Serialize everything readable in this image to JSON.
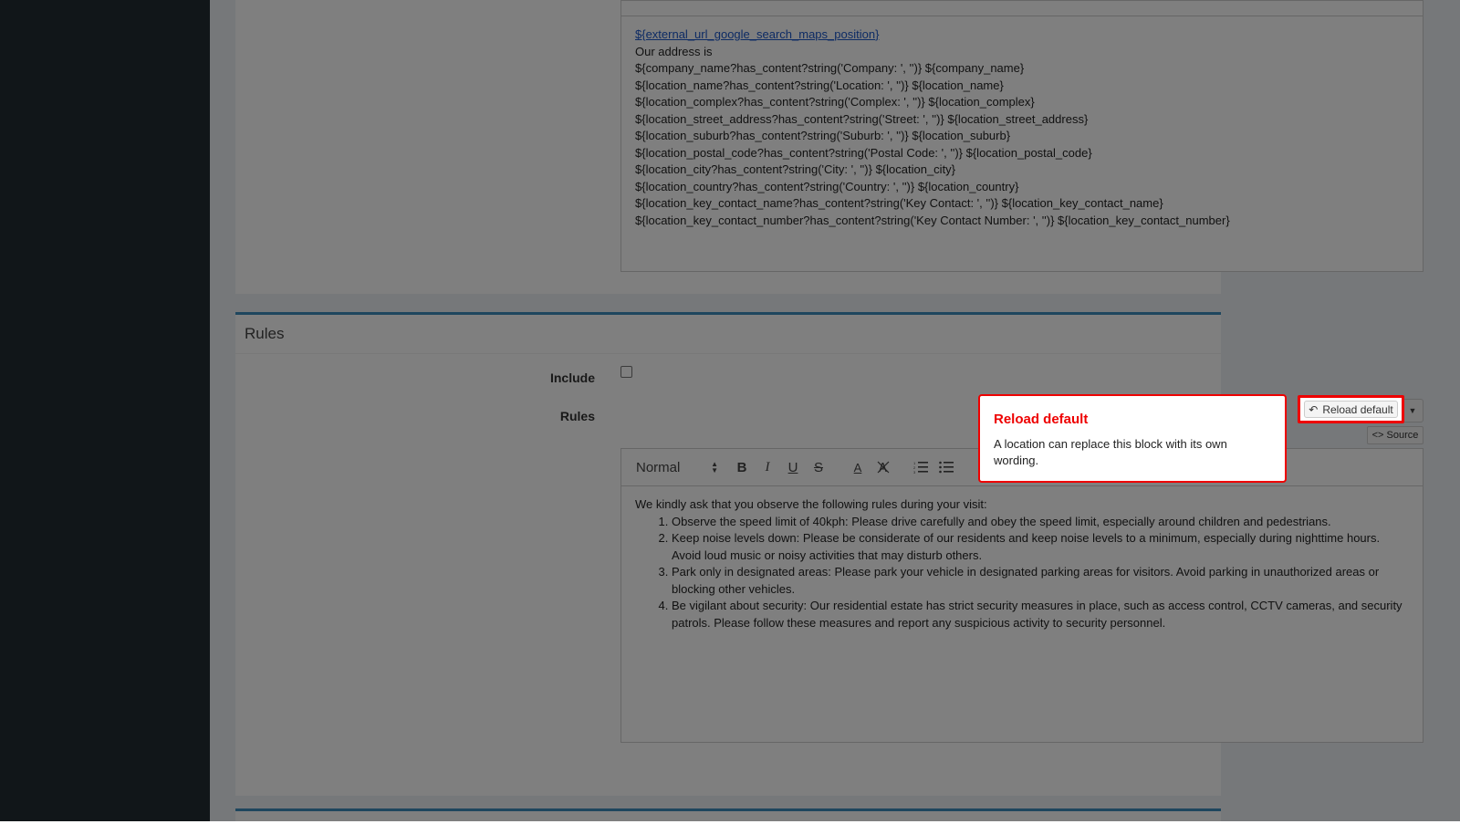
{
  "address_editor": {
    "link": "${external_url_google_search_maps_position}",
    "lines": [
      "Our address is",
      "${company_name?has_content?string('Company: ', '')} ${company_name}",
      "${location_name?has_content?string('Location: ', '')} ${location_name}",
      "${location_complex?has_content?string('Complex: ', '')} ${location_complex}",
      "${location_street_address?has_content?string('Street: ', '')} ${location_street_address}",
      "${location_suburb?has_content?string('Suburb: ', '')} ${location_suburb}",
      "${location_postal_code?has_content?string('Postal Code: ', '')} ${location_postal_code}",
      "${location_city?has_content?string('City: ', '')} ${location_city}",
      "${location_country?has_content?string('Country: ', '')} ${location_country}",
      "${location_key_contact_name?has_content?string('Key Contact: ', '')} ${location_key_contact_name}",
      "${location_key_contact_number?has_content?string('Key Contact Number: ', '')} ${location_key_contact_number}"
    ]
  },
  "rules_panel": {
    "title": "Rules",
    "include_label": "Include",
    "include_checked": false,
    "rules_label": "Rules",
    "reload_button_label": "Reload default",
    "source_button_label": "<> Source",
    "toolbar": {
      "format_select": "Normal",
      "bold": "B",
      "italic": "I",
      "underline": "U",
      "strike": "S",
      "color": "A"
    },
    "intro": "We kindly ask that you observe the following rules during your visit:",
    "items": [
      "Observe the speed limit of 40kph: Please drive carefully and obey the speed limit, especially around children and pedestrians.",
      "Keep noise levels down: Please be considerate of our residents and keep noise levels to a minimum, especially during nighttime hours. Avoid loud music or noisy activities that may disturb others.",
      "Park only in designated areas: Please park your vehicle in designated parking areas for visitors. Avoid parking in unauthorized areas or blocking other vehicles.",
      "Be vigilant about security: Our residential estate has strict security measures in place, such as access control, CCTV cameras, and security patrols. Please follow these measures and report any suspicious activity to security personnel."
    ]
  },
  "tooltip": {
    "title": "Reload default",
    "text": "A location can replace this block with its own wording."
  },
  "colors": {
    "highlight": "#ee0000",
    "sidebar": "#222d32",
    "accent": "#3c8dbc"
  }
}
